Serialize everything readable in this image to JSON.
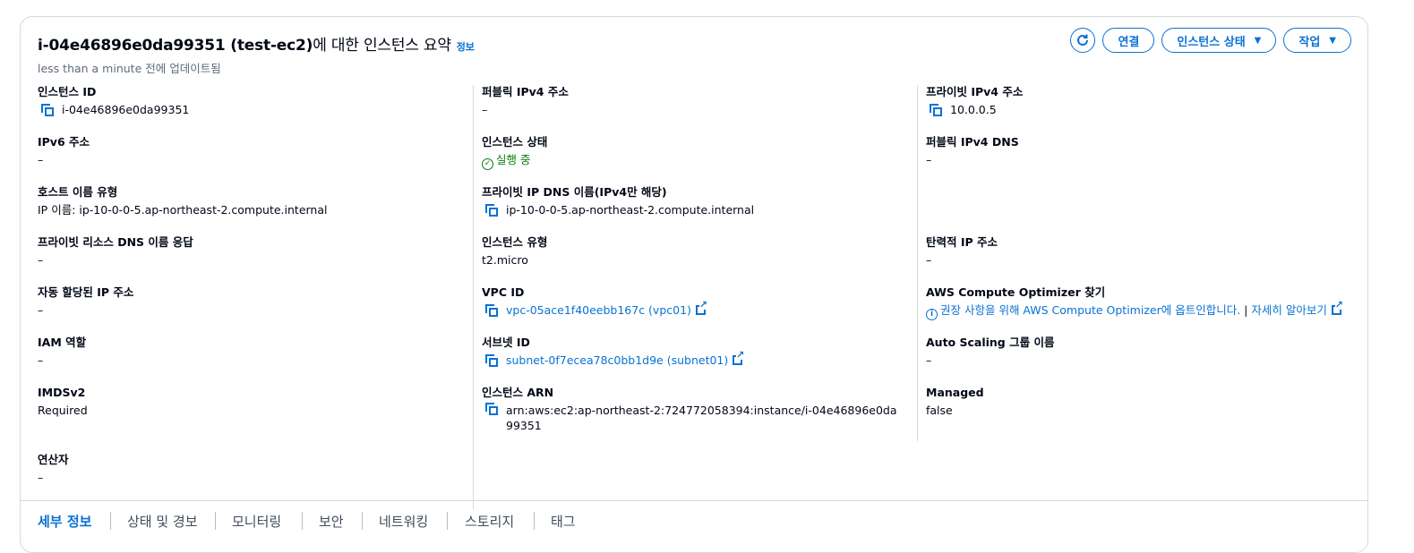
{
  "header": {
    "title_id": "i-04e46896e0da99351 (test-ec2)",
    "title_suffix": "에 대한 인스턴스 요약",
    "info_link": "정보",
    "updated": "less than a minute 전에 업데이트됨"
  },
  "actions": {
    "refresh_icon": "refresh-icon",
    "connect": "연결",
    "instance_state": "인스턴스 상태",
    "actions": "작업"
  },
  "col1": {
    "instance_id_label": "인스턴스 ID",
    "instance_id_value": "i-04e46896e0da99351",
    "ipv6_label": "IPv6 주소",
    "ipv6_value": "–",
    "hostname_type_label": "호스트 이름 유형",
    "hostname_type_value": "IP 이름: ip-10-0-0-5.ap-northeast-2.compute.internal",
    "private_dns_answer_label": "프라이빗 리소스 DNS 이름 응답",
    "private_dns_answer_value": "–",
    "auto_ip_label": "자동 할당된 IP 주소",
    "auto_ip_value": "–",
    "iam_label": "IAM 역할",
    "iam_value": "–",
    "imds_label": "IMDSv2",
    "imds_value": "Required",
    "operator_label": "연산자",
    "operator_value": "–"
  },
  "col2": {
    "public_ipv4_label": "퍼블릭 IPv4 주소",
    "public_ipv4_value": "–",
    "state_label": "인스턴스 상태",
    "state_value": "실행 중",
    "private_ip_dns_label": "프라이빗 IP DNS 이름(IPv4만 해당)",
    "private_ip_dns_value": "ip-10-0-0-5.ap-northeast-2.compute.internal",
    "type_label": "인스턴스 유형",
    "type_value": "t2.micro",
    "vpc_label": "VPC ID",
    "vpc_value": "vpc-05ace1f40eebb167c (vpc01)",
    "subnet_label": "서브넷 ID",
    "subnet_value": "subnet-0f7ecea78c0bb1d9e (subnet01)",
    "arn_label": "인스턴스 ARN",
    "arn_value": "arn:aws:ec2:ap-northeast-2:724772058394:instance/i-04e46896e0da99351"
  },
  "col3": {
    "private_ipv4_label": "프라이빗 IPv4 주소",
    "private_ipv4_value": "10.0.0.5",
    "public_dns_label": "퍼블릭 IPv4 DNS",
    "public_dns_value": "–",
    "elastic_ip_label": "탄력적 IP 주소",
    "elastic_ip_value": "–",
    "optimizer_label": "AWS Compute Optimizer 찾기",
    "optimizer_value": "권장 사항을 위해 AWS Compute Optimizer에 옵트인합니다.",
    "optimizer_sep": " | ",
    "optimizer_learn": "자세히 알아보기",
    "asg_label": "Auto Scaling 그룹 이름",
    "asg_value": "–",
    "managed_label": "Managed",
    "managed_value": "false"
  },
  "tabs": [
    "세부 정보",
    "상태 및 경보",
    "모니터링",
    "보안",
    "네트워킹",
    "스토리지",
    "태그"
  ],
  "colors": {
    "accent": "#0972d3",
    "success": "#037f0c",
    "border": "#d5dbdb"
  }
}
